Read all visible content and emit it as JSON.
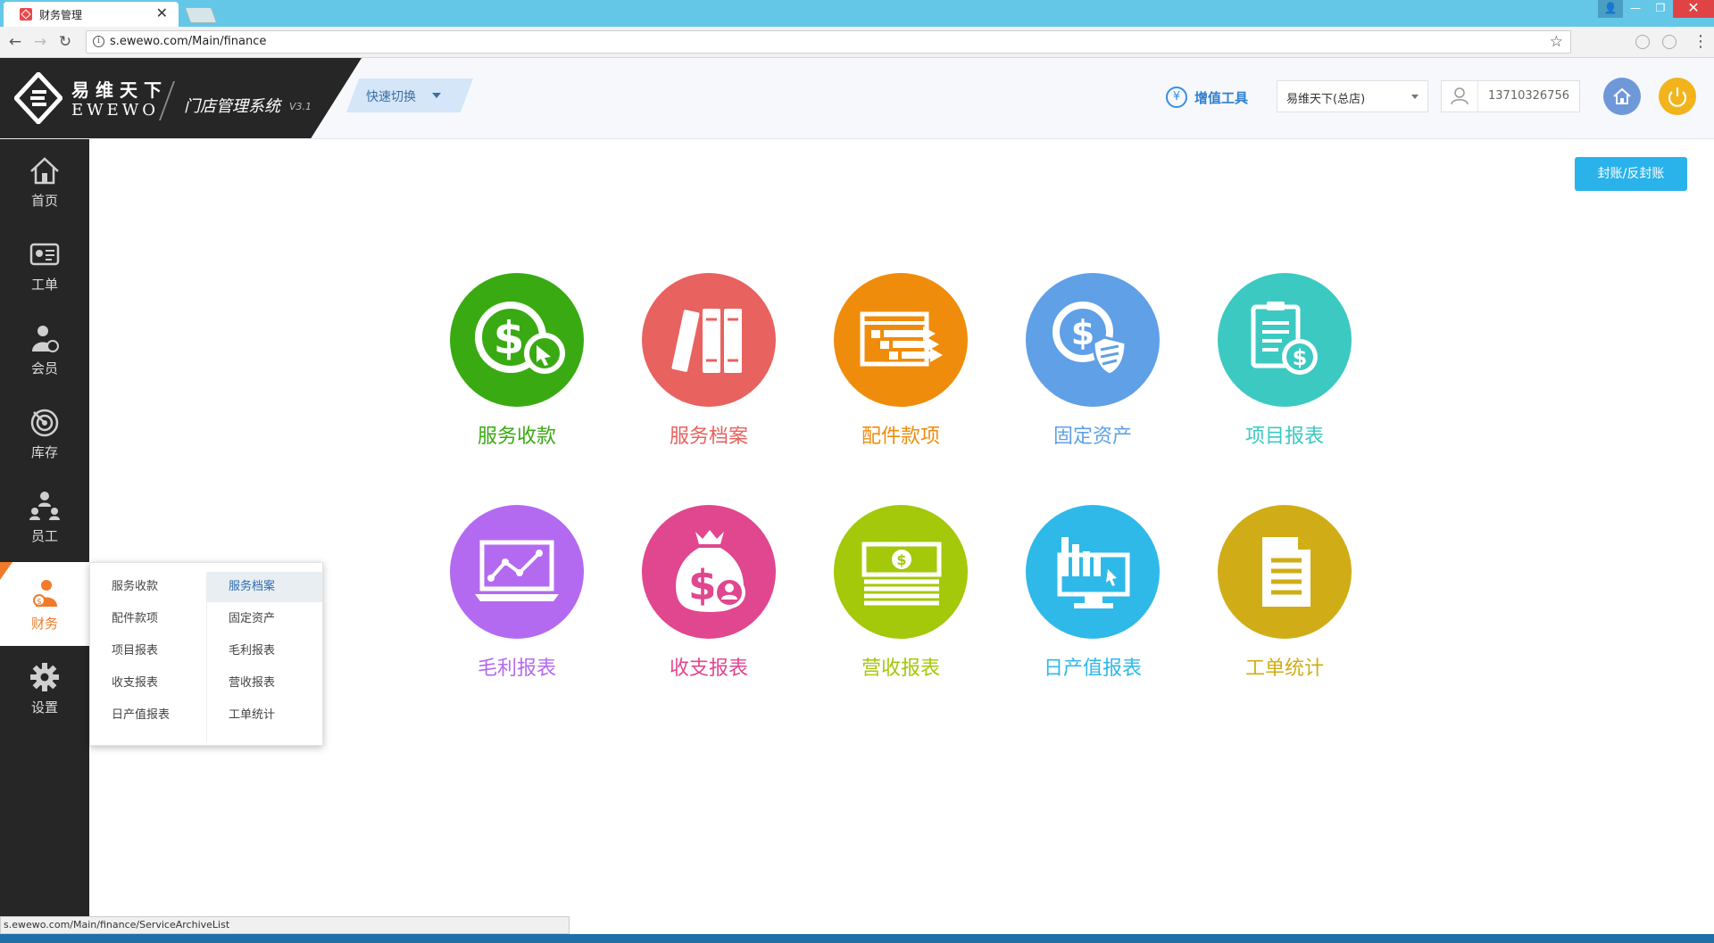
{
  "browser": {
    "tab_title": "财务管理",
    "tab_close": "✕",
    "url": "s.ewewo.com/Main/finance",
    "info_glyph": "i",
    "window": {
      "user": "👤",
      "min": "—",
      "max": "❐",
      "close": "✕"
    }
  },
  "header": {
    "brand_cn": "易维天下",
    "brand_en": "EWEWO",
    "system_name": "门店管理系统",
    "version": "V3.1",
    "quick_switch": "快速切换",
    "value_added_icon": "¥",
    "value_added": "增值工具",
    "store": "易维天下(总店)",
    "phone": "13710326756"
  },
  "sidebar": {
    "items": [
      {
        "label": "首页",
        "icon": "house-icon"
      },
      {
        "label": "工单",
        "icon": "id-card-icon"
      },
      {
        "label": "会员",
        "icon": "member-icon"
      },
      {
        "label": "库存",
        "icon": "target-icon"
      },
      {
        "label": "员工",
        "icon": "org-chart-icon"
      },
      {
        "label": "财务",
        "icon": "finance-icon",
        "active": true
      },
      {
        "label": "设置",
        "icon": "gear-icon"
      }
    ]
  },
  "submenu": {
    "left": [
      "服务收款",
      "配件款项",
      "项目报表",
      "收支报表",
      "日产值报表"
    ],
    "right": [
      "服务档案",
      "固定资产",
      "毛利报表",
      "营收报表",
      "工单统计"
    ],
    "selected": "服务档案"
  },
  "main": {
    "seal_button": "封账/反封账",
    "tiles": [
      {
        "label": "服务收款",
        "color": "#3aaa13",
        "icon": "dollar-cursor-icon"
      },
      {
        "label": "服务档案",
        "color": "#e8625f",
        "icon": "binders-icon"
      },
      {
        "label": "配件款项",
        "color": "#f08c0c",
        "icon": "transfer-list-icon"
      },
      {
        "label": "固定资产",
        "color": "#5fa0e6",
        "icon": "dollar-shield-icon"
      },
      {
        "label": "项目报表",
        "color": "#3cc9c2",
        "icon": "clipboard-dollar-icon"
      },
      {
        "label": "毛利报表",
        "color": "#b36af0",
        "icon": "line-chart-icon"
      },
      {
        "label": "收支报表",
        "color": "#e0478f",
        "icon": "money-bag-icon"
      },
      {
        "label": "营收报表",
        "color": "#a4c80a",
        "icon": "cash-stack-icon"
      },
      {
        "label": "日产值报表",
        "color": "#2fb9e8",
        "icon": "bar-monitor-icon"
      },
      {
        "label": "工单统计",
        "color": "#d0ad16",
        "icon": "document-icon"
      }
    ]
  },
  "status": {
    "link": "s.ewewo.com/Main/finance/ServiceArchiveList"
  }
}
